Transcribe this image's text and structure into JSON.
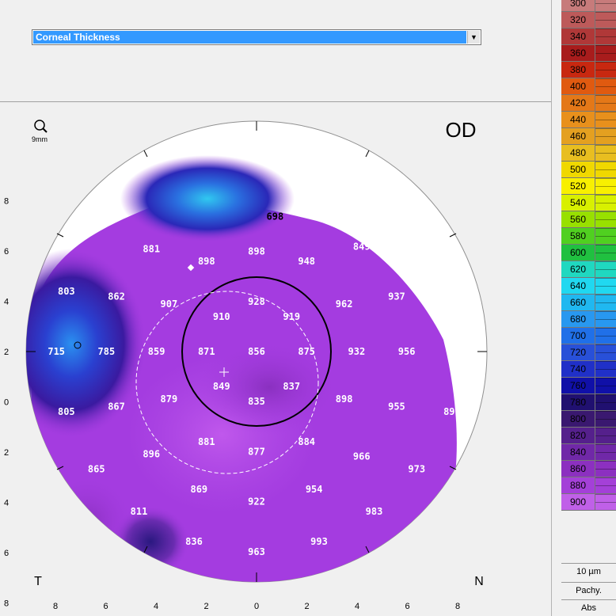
{
  "dropdown": {
    "selected": "Corneal Thickness"
  },
  "map": {
    "eye": "OD",
    "zoom_label": "9mm",
    "label_left": "T",
    "label_right": "N",
    "y_ticks": [
      "8",
      "6",
      "4",
      "2",
      "0",
      "2",
      "4",
      "6",
      "8"
    ],
    "x_ticks": [
      "8",
      "6",
      "4",
      "2",
      "0",
      "2",
      "4",
      "6",
      "8"
    ],
    "thickness_values": [
      {
        "v": "698",
        "u": 0.74,
        "w": -5.4
      },
      {
        "v": "881",
        "u": -4.2,
        "w": -4.1
      },
      {
        "v": "898",
        "u": -2.0,
        "w": -3.6
      },
      {
        "v": "898",
        "u": 0.0,
        "w": -4.0
      },
      {
        "v": "948",
        "u": 2.0,
        "w": -3.6
      },
      {
        "v": "849",
        "u": 4.2,
        "w": -4.2
      },
      {
        "v": "803",
        "u": -7.6,
        "w": -2.4
      },
      {
        "v": "862",
        "u": -5.6,
        "w": -2.2
      },
      {
        "v": "907",
        "u": -3.5,
        "w": -1.9
      },
      {
        "v": "928",
        "u": 0.0,
        "w": -2.0
      },
      {
        "v": "962",
        "u": 3.5,
        "w": -1.9
      },
      {
        "v": "937",
        "u": 5.6,
        "w": -2.2
      },
      {
        "v": "910",
        "u": -1.4,
        "w": -1.4
      },
      {
        "v": "919",
        "u": 1.4,
        "w": -1.4
      },
      {
        "v": "715",
        "u": -8.0,
        "w": 0.0
      },
      {
        "v": "785",
        "u": -6.0,
        "w": 0.0
      },
      {
        "v": "859",
        "u": -4.0,
        "w": 0.0
      },
      {
        "v": "871",
        "u": -2.0,
        "w": 0.0
      },
      {
        "v": "856",
        "u": 0.0,
        "w": 0.0
      },
      {
        "v": "875",
        "u": 2.0,
        "w": 0.0
      },
      {
        "v": "932",
        "u": 4.0,
        "w": 0.0
      },
      {
        "v": "956",
        "u": 6.0,
        "w": 0.0
      },
      {
        "v": "849",
        "u": -1.4,
        "w": 1.4
      },
      {
        "v": "837",
        "u": 1.4,
        "w": 1.4
      },
      {
        "v": "835",
        "u": 0.0,
        "w": 2.0
      },
      {
        "v": "805",
        "u": -7.6,
        "w": 2.4
      },
      {
        "v": "867",
        "u": -5.6,
        "w": 2.2
      },
      {
        "v": "879",
        "u": -3.5,
        "w": 1.9
      },
      {
        "v": "898",
        "u": 3.5,
        "w": 1.9
      },
      {
        "v": "955",
        "u": 5.6,
        "w": 2.2
      },
      {
        "v": "89",
        "u": 7.7,
        "w": 2.4
      },
      {
        "v": "881",
        "u": -2.0,
        "w": 3.6
      },
      {
        "v": "877",
        "u": 0.0,
        "w": 4.0
      },
      {
        "v": "884",
        "u": 2.0,
        "w": 3.6
      },
      {
        "v": "896",
        "u": -4.2,
        "w": 4.1
      },
      {
        "v": "966",
        "u": 4.2,
        "w": 4.2
      },
      {
        "v": "865",
        "u": -6.4,
        "w": 4.7
      },
      {
        "v": "973",
        "u": 6.4,
        "w": 4.7
      },
      {
        "v": "869",
        "u": -2.3,
        "w": 5.5
      },
      {
        "v": "922",
        "u": 0.0,
        "w": 6.0
      },
      {
        "v": "954",
        "u": 2.3,
        "w": 5.5
      },
      {
        "v": "811",
        "u": -4.7,
        "w": 6.4
      },
      {
        "v": "983",
        "u": 4.7,
        "w": 6.4
      },
      {
        "v": "836",
        "u": -2.5,
        "w": 7.6
      },
      {
        "v": "963",
        "u": 0.0,
        "w": 8.0
      },
      {
        "v": "993",
        "u": 2.5,
        "w": 7.6
      }
    ]
  },
  "scale": {
    "swatches": [
      {
        "label": "300",
        "color": "#c77b7b"
      },
      {
        "label": "320",
        "color": "#bd5a5a"
      },
      {
        "label": "340",
        "color": "#b03838"
      },
      {
        "label": "360",
        "color": "#a81c1c"
      },
      {
        "label": "380",
        "color": "#c82810"
      },
      {
        "label": "400",
        "color": "#e05a10"
      },
      {
        "label": "420",
        "color": "#e47818"
      },
      {
        "label": "440",
        "color": "#e8901c"
      },
      {
        "label": "460",
        "color": "#e4a020"
      },
      {
        "label": "480",
        "color": "#e8be20"
      },
      {
        "label": "500",
        "color": "#f0d800"
      },
      {
        "label": "520",
        "color": "#f8f000"
      },
      {
        "label": "540",
        "color": "#d8f000"
      },
      {
        "label": "560",
        "color": "#98e000"
      },
      {
        "label": "580",
        "color": "#50d020"
      },
      {
        "label": "600",
        "color": "#20c040"
      },
      {
        "label": "620",
        "color": "#20d8c0"
      },
      {
        "label": "640",
        "color": "#20d8f0"
      },
      {
        "label": "660",
        "color": "#20b8f0"
      },
      {
        "label": "680",
        "color": "#2898f0"
      },
      {
        "label": "700",
        "color": "#2070e8"
      },
      {
        "label": "720",
        "color": "#2850d8"
      },
      {
        "label": "740",
        "color": "#2030c8"
      },
      {
        "label": "760",
        "color": "#1010a8"
      },
      {
        "label": "780",
        "color": "#201070"
      },
      {
        "label": "800",
        "color": "#3a1870"
      },
      {
        "label": "820",
        "color": "#55208c"
      },
      {
        "label": "840",
        "color": "#7028a8"
      },
      {
        "label": "860",
        "color": "#8c30c0"
      },
      {
        "label": "880",
        "color": "#a440d8"
      },
      {
        "label": "900",
        "color": "#c060e8"
      }
    ],
    "step_label": "10 µm",
    "mode_label": "Pachy.",
    "abs_label": "Abs"
  }
}
